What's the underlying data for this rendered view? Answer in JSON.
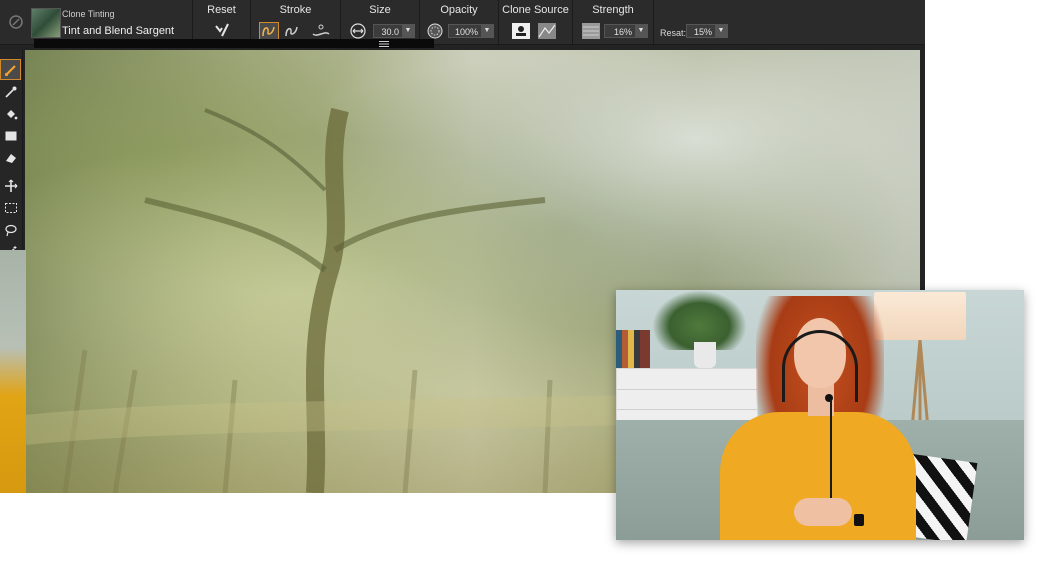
{
  "property_bar": {
    "brush": {
      "category": "Clone Tinting",
      "variant": "Tint and Blend Sargent"
    },
    "sections": {
      "reset": "Reset",
      "stroke": "Stroke",
      "size": "Size",
      "opacity": "Opacity",
      "clone_source": "Clone Source",
      "strength": "Strength"
    },
    "values": {
      "size": "30.0",
      "opacity": "100%",
      "strength": "16%",
      "resat_label": "Resat:",
      "resat": "15%"
    }
  },
  "toolbox": {
    "active_tool": "brush",
    "tools": [
      "brush",
      "dropper",
      "paint-bucket",
      "rectangle-fill",
      "eraser",
      "transform",
      "rect-select",
      "lasso",
      "magic-wand"
    ]
  },
  "colors": {
    "app_background": "#232323",
    "property_bar": "#2b2b2b",
    "active_outline": "#d28a2a",
    "sweater": "#f0a922",
    "hair": "#a83c15"
  }
}
